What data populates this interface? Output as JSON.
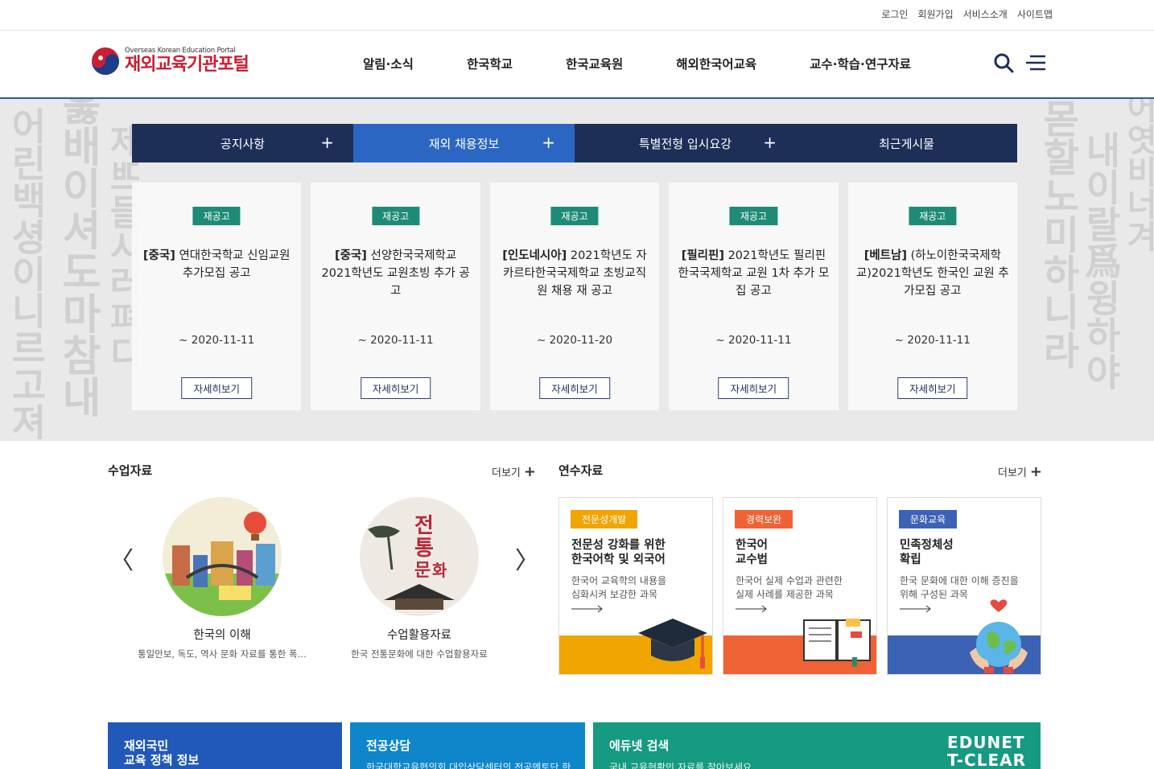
{
  "util": {
    "links": [
      "로그인",
      "회원가입",
      "서비스소개",
      "사이트맵"
    ]
  },
  "logo": {
    "sub": "Overseas Korean Education Portal",
    "main": "재외교육기관포털"
  },
  "nav": {
    "items": [
      "알림·소식",
      "한국학교",
      "한국교육원",
      "해외한국어교육",
      "교수·학습·연구자료"
    ]
  },
  "tabs": [
    {
      "label": "공지사항",
      "plus": "+"
    },
    {
      "label": "재외 채용정보",
      "plus": "+"
    },
    {
      "label": "특별전형 입시요강",
      "plus": "+"
    },
    {
      "label": "최근게시물",
      "plus": ""
    }
  ],
  "cards": [
    {
      "badge": "재공고",
      "region": "[중국]",
      "title": " 연대한국학교 신임교원 추가모집 공고",
      "date": "~ 2020-11-11",
      "button": "자세히보기"
    },
    {
      "badge": "재공고",
      "region": "[중국]",
      "title": " 선양한국국제학교 2021학년도 교원초빙 추가 공고",
      "date": "~ 2020-11-11",
      "button": "자세히보기"
    },
    {
      "badge": "재공고",
      "region": "[인도네시아]",
      "title": " 2021학년도 자카르타한국국제학교 초빙교직원 채용 재 공고",
      "date": "~ 2020-11-20",
      "button": "자세히보기"
    },
    {
      "badge": "재공고",
      "region": "[필리핀]",
      "title": " 2021학년도 필리핀 한국국제학교 교원 1차 추가 모집 공고",
      "date": "~ 2020-11-11",
      "button": "자세히보기"
    },
    {
      "badge": "재공고",
      "region": "[베트남]",
      "title": " (하노이한국국제학교)2021학년도 한국인 교원 추가모집 공고",
      "date": "~ 2020-11-11",
      "button": "자세히보기"
    }
  ],
  "lessons": {
    "title": "수업자료",
    "more": "더보기",
    "prev": "〈",
    "next": "〉",
    "items": [
      {
        "title": "한국의 이해",
        "desc": "통일안보, 독도, 역사 문화 자료를 통한 폭…"
      },
      {
        "title": "수업활용자료",
        "desc": "한국 전통문화에 대한 수업활용자료",
        "art": "전통문화"
      }
    ]
  },
  "training": {
    "title": "연수자료",
    "more": "더보기",
    "items": [
      {
        "badge": "전문성개발",
        "title1": "전문성 강화를 위한",
        "title2": "한국어학 및 외국어",
        "desc1": "한국어 교육학의 내용을",
        "desc2": "심화시켜 보강한 과목",
        "color": "#f0a500"
      },
      {
        "badge": "경력보완",
        "title1": "한국어",
        "title2": "교수법",
        "desc1": "한국어 실제 수업과 관련한",
        "desc2": "실제 사례를 제공한 과목",
        "color": "#ee6236"
      },
      {
        "badge": "문화교육",
        "title1": "민족정체성",
        "title2": "확립",
        "desc1": "한국 문화에 대한 이해 증진을",
        "desc2": "위해 구성된 과목",
        "color": "#3c62b5"
      }
    ]
  },
  "banners": [
    {
      "title1": "재외국민",
      "title2": "교육 정책 정보",
      "desc": "",
      "color": "#2059b8"
    },
    {
      "title1": "전공상담",
      "title2": "",
      "desc": "한국대학교육협의회 대입상담센터의 전공멘토단 한",
      "color": "#0f86c9"
    },
    {
      "title1": "에듀넷 검색",
      "title2": "",
      "desc": "국내 교육현황민 자료를 찾아보세요",
      "logo1": "EDUNET",
      "logo2": "T-CLEAR",
      "color": "#169a82"
    }
  ]
}
